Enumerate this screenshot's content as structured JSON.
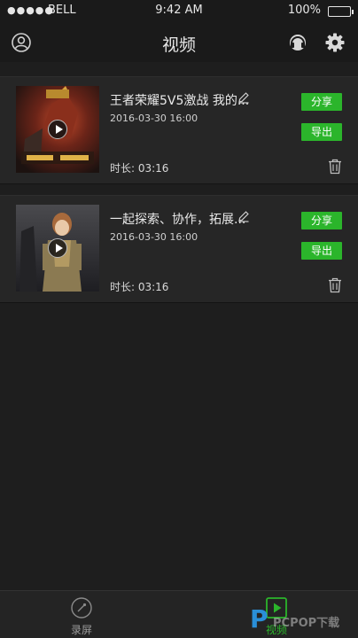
{
  "status_bar": {
    "signal": "●●●●●",
    "carrier": "BELL",
    "time": "9:42 AM",
    "battery": "100%"
  },
  "nav": {
    "title": "视频",
    "icons": [
      "user-icon",
      "headset-icon",
      "gear-icon"
    ]
  },
  "videos": [
    {
      "title": "王者荣耀5V5激战 我的...",
      "date": "2016-03-30 16:00",
      "duration": "时长: 03:16",
      "share_label": "分享",
      "export_label": "导出"
    },
    {
      "title": "一起探索、协作，拓展...",
      "date": "2016-03-30 16:00",
      "duration": "时长: 03:16",
      "share_label": "分享",
      "export_label": "导出"
    }
  ],
  "tabs": [
    {
      "label": "录屏",
      "icon": "record-icon"
    },
    {
      "label": "视频",
      "icon": "video-play-icon"
    }
  ],
  "watermark": {
    "letter": "P",
    "text": "PCPOP下载"
  },
  "colors": {
    "accent": "#2bb52b",
    "background": "#1e1e1e",
    "card": "#262626",
    "bar": "#1a1a1a"
  }
}
